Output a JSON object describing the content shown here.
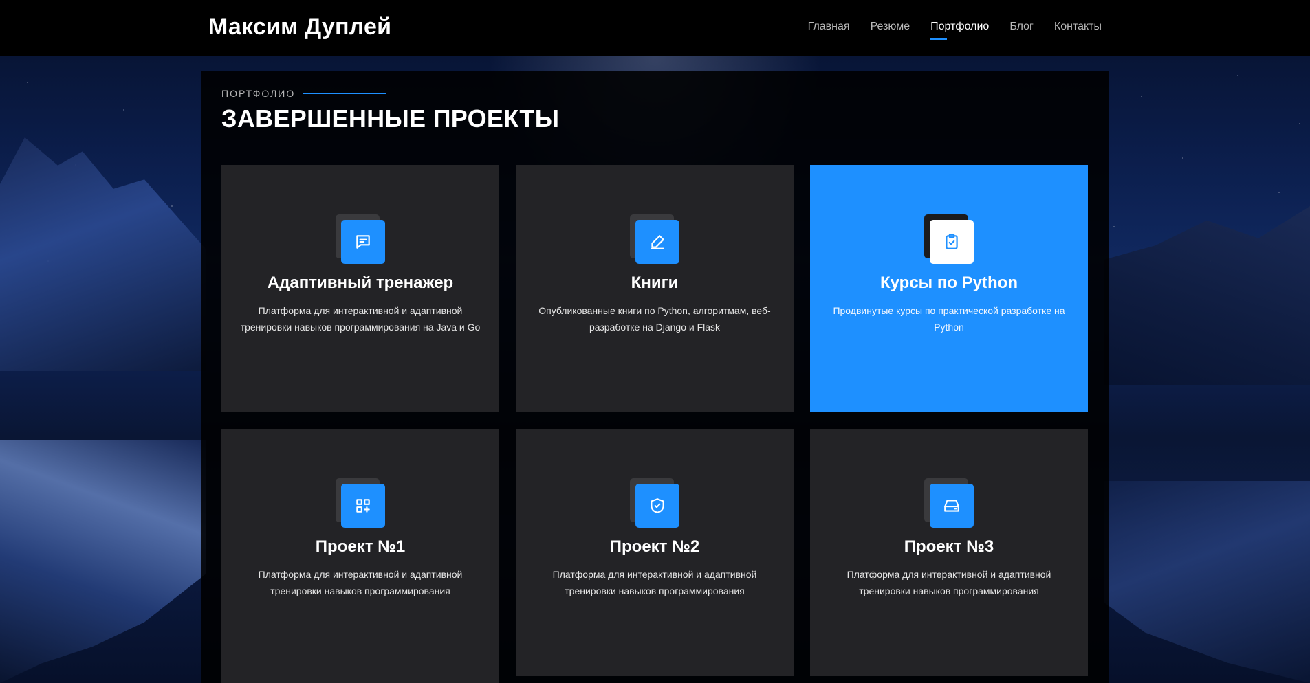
{
  "header": {
    "brand": "Максим Дуплей",
    "nav": [
      {
        "label": "Главная",
        "active": false
      },
      {
        "label": "Резюме",
        "active": false
      },
      {
        "label": "Портфолио",
        "active": true
      },
      {
        "label": "Блог",
        "active": false
      },
      {
        "label": "Контакты",
        "active": false
      }
    ]
  },
  "section": {
    "eyebrow": "ПОРТФОЛИО",
    "title": "ЗАВЕРШЕННЫЕ ПРОЕКТЫ"
  },
  "cards": [
    {
      "icon": "chat-icon",
      "title": "Адаптивный тренажер",
      "desc": "Платформа для интерактивной и адаптивной тренировки навыков программирования на Java и Go",
      "highlight": false
    },
    {
      "icon": "pen-icon",
      "title": "Книги",
      "desc": "Опубликованные книги по Python, алгоритмам, веб-разработке на Django и Flask",
      "highlight": false
    },
    {
      "icon": "clipboard-check-icon",
      "title": "Курсы по Python",
      "desc": "Продвинутые курсы по практической разработке на Python",
      "highlight": true
    },
    {
      "icon": "qr-grid-icon",
      "title": "Проект №1",
      "desc": "Платформа для интерактивной и адаптивной тренировки навыков программирования",
      "highlight": false
    },
    {
      "icon": "shield-check-icon",
      "title": "Проект №2",
      "desc": "Платформа для интерактивной и адаптивной тренировки навыков программирования",
      "highlight": false
    },
    {
      "icon": "drive-icon",
      "title": "Проект №3",
      "desc": "Платформа для интерактивной и адаптивной тренировки навыков программирования",
      "highlight": false
    }
  ],
  "colors": {
    "accent": "#1e90ff",
    "card_bg": "#262629",
    "panel_bg": "#000000"
  }
}
